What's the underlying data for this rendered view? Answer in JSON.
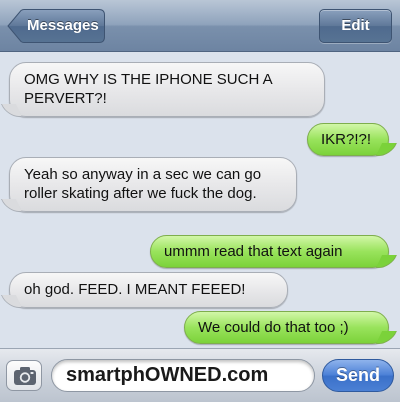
{
  "navbar": {
    "back_label": "Messages",
    "edit_label": "Edit"
  },
  "messages": [
    {
      "direction": "incoming",
      "text": "OMG WHY IS THE IPHONE SUCH A PERVERT?!"
    },
    {
      "direction": "outgoing",
      "text": "IKR?!?!"
    },
    {
      "direction": "incoming",
      "text": "Yeah so anyway in a sec we can go roller skating after we fuck the dog."
    },
    {
      "direction": "outgoing",
      "text": "ummm read that text again"
    },
    {
      "direction": "incoming",
      "text": "oh god. FEED. I MEANT FEEED!"
    },
    {
      "direction": "outgoing",
      "text": "We could do that too ;)"
    }
  ],
  "composer": {
    "camera_icon": "camera-icon",
    "input_value": "smartphOWNED.com",
    "send_label": "Send"
  },
  "colors": {
    "incoming_bubble": "#e8e8ea",
    "outgoing_bubble": "#99e35c",
    "navbar": "#8fa3bc",
    "send_button": "#4a7fd6",
    "background": "#dbe2ec"
  }
}
